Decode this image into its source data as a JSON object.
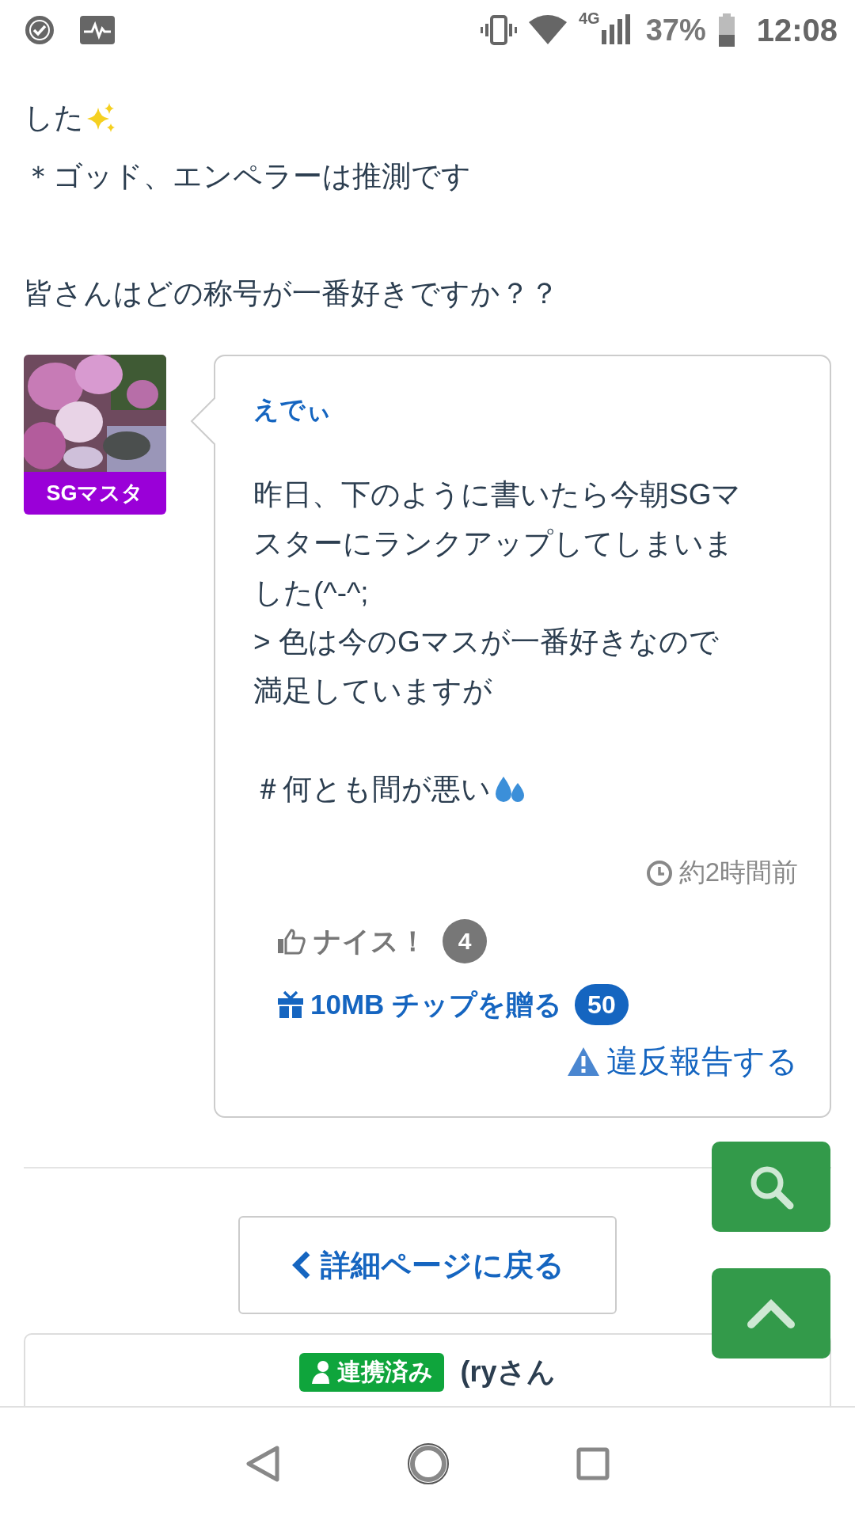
{
  "status_bar": {
    "network": "4G",
    "battery": "37%",
    "time": "12:08"
  },
  "post_tail": [
    {
      "lines": [
        {
          "kind": "sparkles",
          "text": "した"
        },
        {
          "kind": "plain",
          "text": "＊ゴッド、エンペラーは推測です"
        }
      ]
    },
    {
      "lines": [
        {
          "kind": "plain",
          "text": "皆さんはどの称号が一番好きですか？？"
        }
      ]
    }
  ],
  "comment": {
    "rank_badge": "SGマスタ",
    "author": "えでぃ",
    "body": [
      {
        "lines": [
          {
            "kind": "plain",
            "text": "昨日、下のように書いたら今朝SGマ"
          },
          {
            "kind": "plain",
            "text": "スターにランクアップしてしまいま"
          },
          {
            "kind": "plain",
            "text": "した(^-^;"
          },
          {
            "kind": "plain",
            "text": "> 色は今のGマスが一番好きなので"
          },
          {
            "kind": "plain",
            "text": "満足していますが"
          }
        ]
      },
      {
        "lines": [
          {
            "kind": "droplets",
            "text": "＃何とも間が悪い"
          }
        ]
      }
    ],
    "time": "約2時間前",
    "nice": {
      "label": "ナイス！",
      "count": "4"
    },
    "tip": {
      "label": "10MB チップを贈る",
      "count": "50"
    },
    "report": "違反報告する"
  },
  "back_button": "詳細ページに戻る",
  "next_card": {
    "badge": "連携済み",
    "name": "(ryさん"
  }
}
